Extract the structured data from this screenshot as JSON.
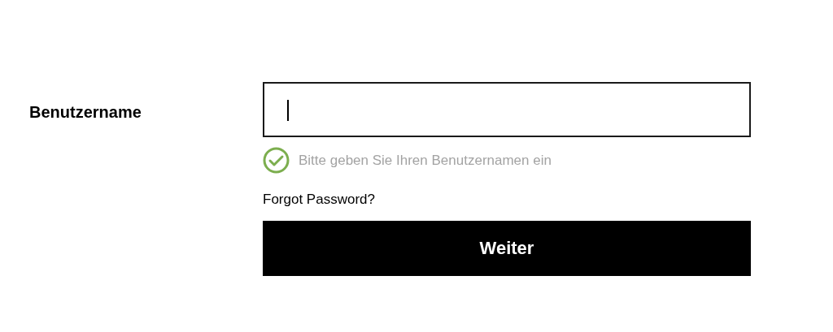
{
  "username": {
    "label": "Benutzername",
    "focused": true
  },
  "hint": {
    "text": "Bitte geben Sie Ihren Benutzernamen ein",
    "valid": true
  },
  "forgot_link": "Forgot Password?",
  "submit_button": "Weiter"
}
